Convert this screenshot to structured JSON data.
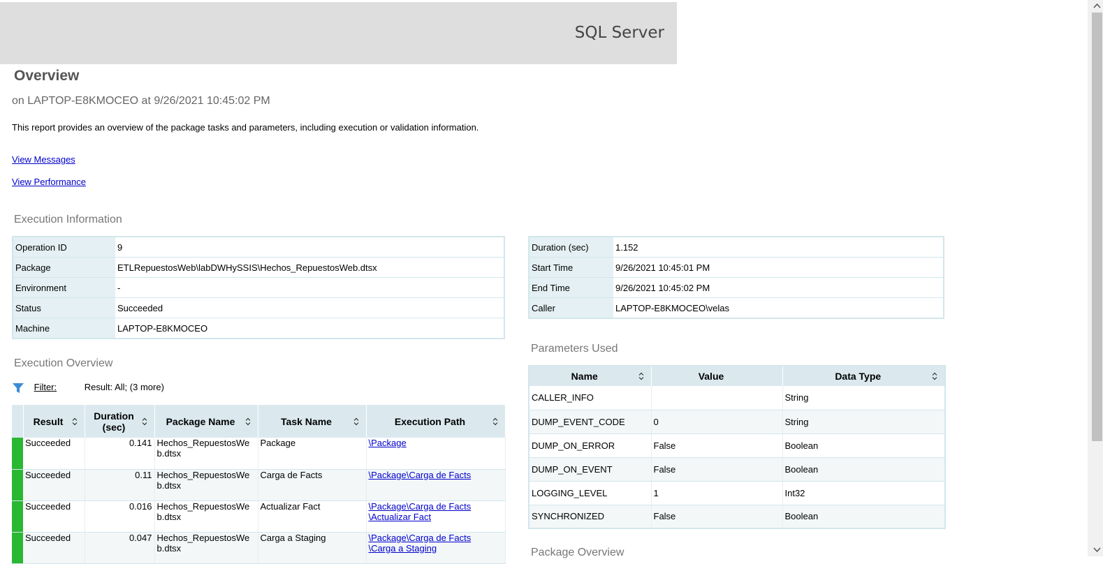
{
  "banner": {
    "product": "SQL Server"
  },
  "report": {
    "title": "Overview",
    "subtitle": "on LAPTOP-E8KMOCEO at 9/26/2021 10:45:02 PM",
    "description": "This report provides an overview of the package tasks and parameters, including execution or validation information."
  },
  "links": {
    "messages": "View Messages",
    "performance": "View Performance"
  },
  "execution_info": {
    "title": "Execution Information",
    "left": [
      {
        "key": "Operation ID",
        "value": "9"
      },
      {
        "key": "Package",
        "value": "ETLRepuestosWeb\\labDWHySSIS\\Hechos_RepuestosWeb.dtsx"
      },
      {
        "key": "Environment",
        "value": "-"
      },
      {
        "key": "Status",
        "value": "Succeeded"
      },
      {
        "key": "Machine",
        "value": "LAPTOP-E8KMOCEO"
      }
    ],
    "right": [
      {
        "key": "Duration (sec)",
        "value": "1.152"
      },
      {
        "key": "Start Time",
        "value": "9/26/2021 10:45:01 PM"
      },
      {
        "key": "End Time",
        "value": "9/26/2021 10:45:02 PM"
      },
      {
        "key": "Caller",
        "value": "LAPTOP-E8KMOCEO\\velas"
      }
    ]
  },
  "execution_overview": {
    "title": "Execution Overview",
    "filter_label": "Filter:",
    "filter_value": "Result: All;  (3 more)",
    "columns": [
      "Result",
      "Duration (sec)",
      "Package Name",
      "Task Name",
      "Execution Path"
    ],
    "rows": [
      {
        "result": "Succeeded",
        "duration": "0.141",
        "package": "Hechos_RepuestosWeb.dtsx",
        "task": "Package",
        "path": "\\Package",
        "path2": ""
      },
      {
        "result": "Succeeded",
        "duration": "0.11",
        "package": "Hechos_RepuestosWeb.dtsx",
        "task": "Carga de Facts",
        "path": "\\Package\\Carga de Facts",
        "path2": ""
      },
      {
        "result": "Succeeded",
        "duration": "0.016",
        "package": "Hechos_RepuestosWeb.dtsx",
        "task": "Actualizar Fact",
        "path": "\\Package\\Carga de Facts",
        "path2": "\\Actualizar Fact"
      },
      {
        "result": "Succeeded",
        "duration": "0.047",
        "package": "Hechos_RepuestosWeb.dtsx",
        "task": "Carga a Staging",
        "path": "\\Package\\Carga de Facts",
        "path2": "\\Carga a Staging"
      }
    ]
  },
  "parameters": {
    "title": "Parameters Used",
    "columns": [
      "Name",
      "Value",
      "Data Type"
    ],
    "rows": [
      {
        "name": "CALLER_INFO",
        "value": "",
        "type": "String"
      },
      {
        "name": "DUMP_EVENT_CODE",
        "value": "0",
        "type": "String"
      },
      {
        "name": "DUMP_ON_ERROR",
        "value": "False",
        "type": "Boolean"
      },
      {
        "name": "DUMP_ON_EVENT",
        "value": "False",
        "type": "Boolean"
      },
      {
        "name": "LOGGING_LEVEL",
        "value": "1",
        "type": "Int32"
      },
      {
        "name": "SYNCHRONIZED",
        "value": "False",
        "type": "Boolean"
      }
    ]
  },
  "next_section": {
    "title": "Package Overview"
  },
  "colors": {
    "success": "#2ab732",
    "header_bg": "#dbe9ef",
    "link": "#0000cc"
  }
}
